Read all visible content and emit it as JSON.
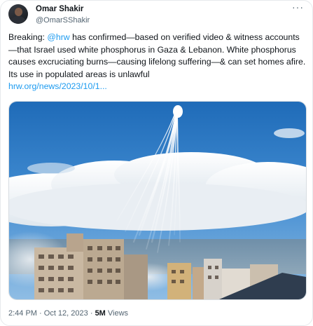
{
  "author": {
    "name": "Omar Shakir",
    "handle": "@OmarSShakir"
  },
  "more_menu": "···",
  "tweet": {
    "prefix": "Breaking: ",
    "mention": "@hrw",
    "body": " has confirmed—based on verified video & witness accounts—that Israel used white phosphorus in Gaza & Lebanon. White phosphorus causes excruciating burns—causing lifelong suffering—& can set homes afire. Its use in populated areas is unlawful",
    "link": "hrw.org/news/2023/10/1..."
  },
  "meta": {
    "time": "2:44 PM",
    "separator": "·",
    "date": "Oct 12, 2023",
    "views_count": "5M",
    "views_label": "Views"
  },
  "colors": {
    "link": "#1d9bf0",
    "muted": "#536471",
    "text": "#0f1419"
  }
}
